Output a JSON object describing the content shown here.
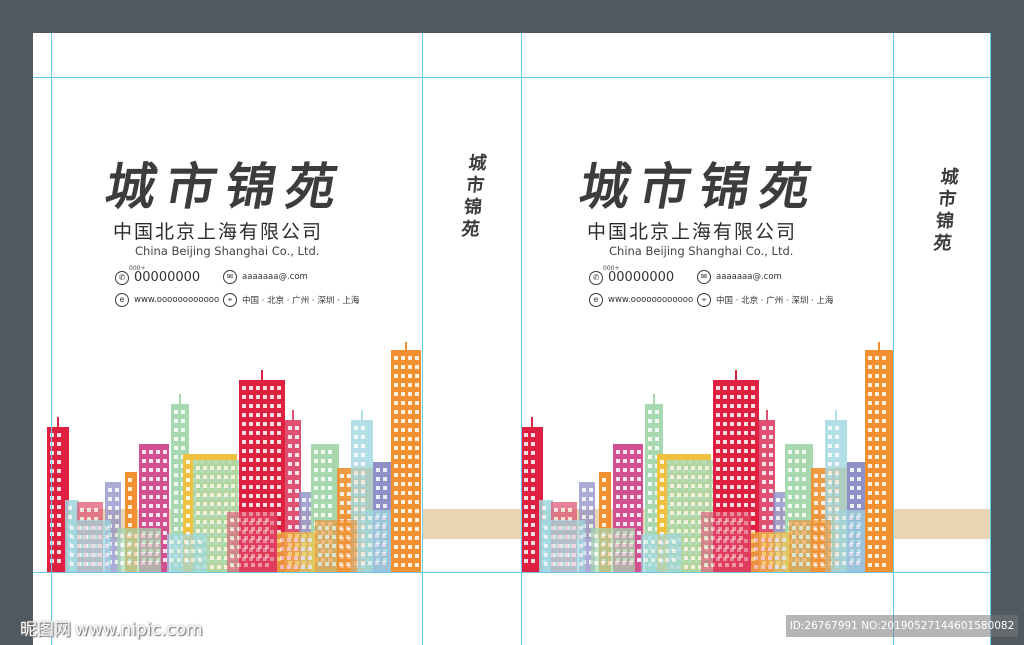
{
  "panels": [
    {
      "brand": "城市锦苑",
      "company_cn": "中国北京上海有限公司",
      "company_en": "China Beijing Shanghai Co., Ltd.",
      "phone_prefix": "000+",
      "phone": "00000000",
      "email": "aaaaaaa@.com",
      "website": "www.oooooooooooo",
      "address": "中国 · 北京 · 广州 · 深圳 · 上海"
    },
    {
      "brand": "城市锦苑",
      "company_cn": "中国北京上海有限公司",
      "company_en": "China Beijing Shanghai Co., Ltd.",
      "phone_prefix": "000+",
      "phone": "00000000",
      "email": "aaaaaaa@.com",
      "website": "www.oooooooooooo",
      "address": "中国 · 北京 · 广州 · 深圳 · 上海"
    }
  ],
  "side_panels": [
    {
      "brand": "城市锦苑"
    },
    {
      "brand": "城市锦苑"
    }
  ],
  "icons": {
    "phone": "phone-icon",
    "email": "mail-icon",
    "website": "globe-icon",
    "address": "location-pin-icon"
  },
  "watermark": {
    "logo_text": "昵图网",
    "site": "www.nipic.com",
    "image_id": "ID:26767991 NO:20190527144601580082"
  },
  "colors": {
    "background": "#505860",
    "guide": "#66ccee",
    "band": "#e8d6b4",
    "text": "#3c3c3c",
    "buildings": [
      "#e02040",
      "#f09030",
      "#a8d8b0",
      "#d05090",
      "#e05070",
      "#9090c8",
      "#f0c040",
      "#a0d8e0"
    ]
  }
}
